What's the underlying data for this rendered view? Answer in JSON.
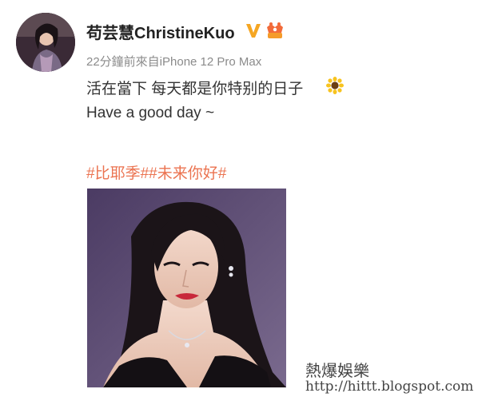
{
  "post": {
    "author": {
      "name": "苟芸慧ChristineKuo",
      "verified_icon": "verified-v-icon",
      "rank_icon": "member-crown-icon"
    },
    "meta": "22分鐘前來自iPhone 12 Pro Max",
    "text_line_1": "活在當下 每天都是你特别的日子",
    "text_line_1_emoji": "sunflower-icon",
    "text_line_2": "Have a good day ~",
    "hashtags": "#比耶季##未来你好#",
    "photo_icon": "portrait-photo"
  },
  "watermark": {
    "site_name": "熱爆娛樂",
    "url": "http://hittt.blogspot.com"
  },
  "colors": {
    "hashtag": "#eb7350",
    "meta": "#8b8b8b",
    "verified": "#f5a623"
  }
}
